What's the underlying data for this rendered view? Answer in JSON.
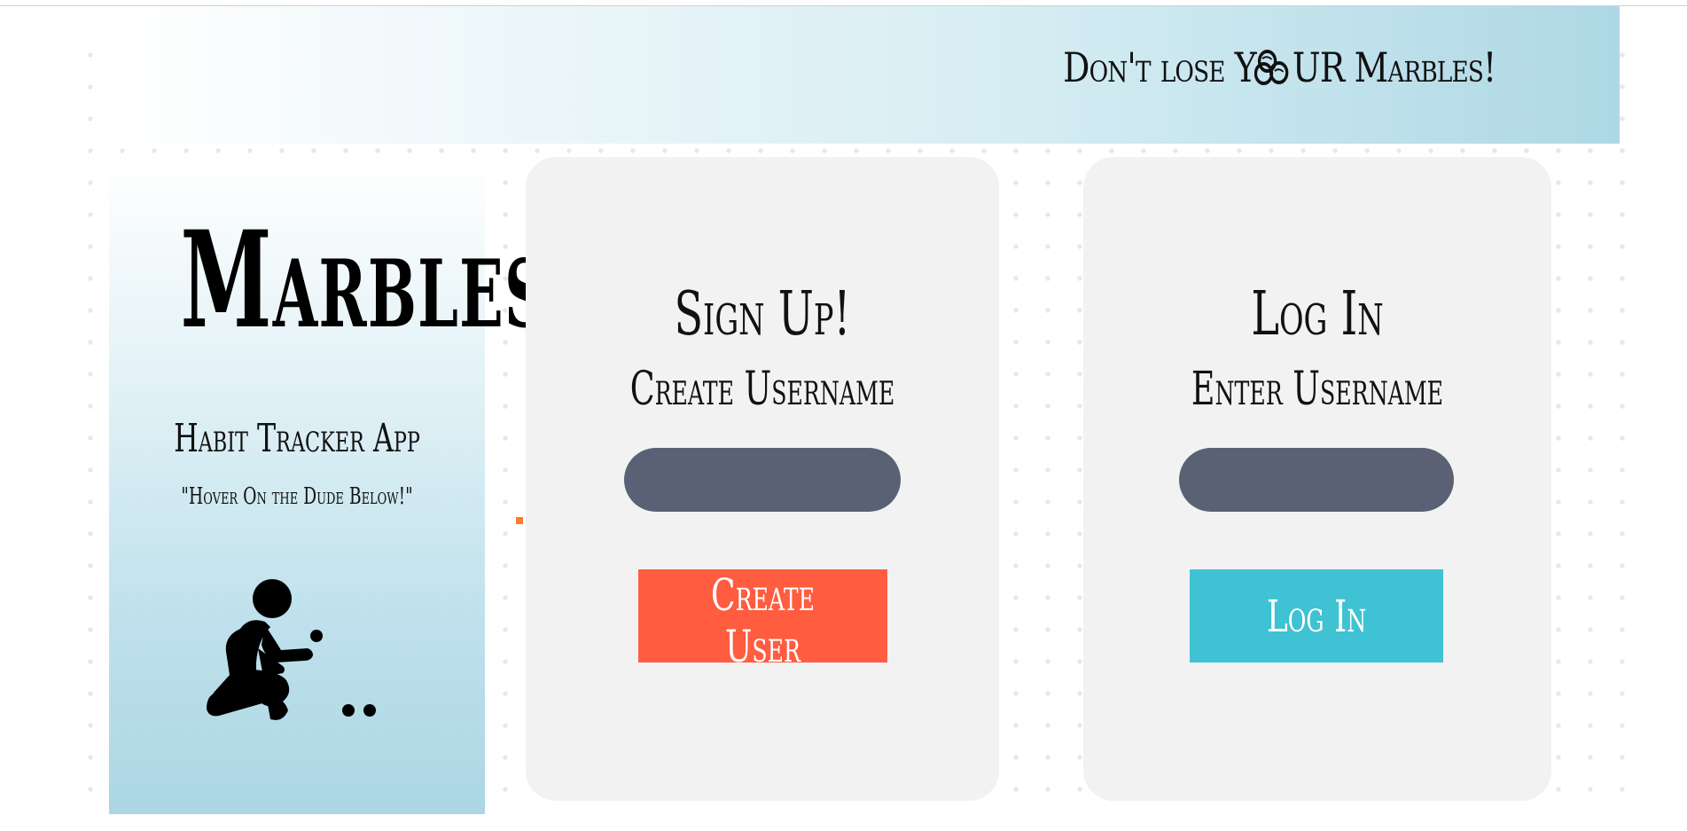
{
  "banner": {
    "tagline_before": "Don't lose Y",
    "tagline_icon": "marbles-icon",
    "tagline_after": "UR Marbles!"
  },
  "sidebar": {
    "title": "Marbles",
    "subtitle": "Habit Tracker App",
    "hint": "\"Hover On the Dude Below!\"",
    "illustration": "crouching-person-with-marbles-icon"
  },
  "signup": {
    "heading": "Sign Up!",
    "field_label": "Create Username",
    "input_value": "",
    "input_placeholder": "",
    "button_label": "Create User"
  },
  "login": {
    "heading": "Log In",
    "field_label": "Enter Username",
    "input_value": "",
    "input_placeholder": "",
    "button_label": "Log In"
  },
  "colors": {
    "signup_button": "#ff5c40",
    "login_button": "#3fc2d3",
    "input_background": "#5a6174",
    "card_background": "#f2f2f2",
    "banner_end": "#aed8e5"
  }
}
